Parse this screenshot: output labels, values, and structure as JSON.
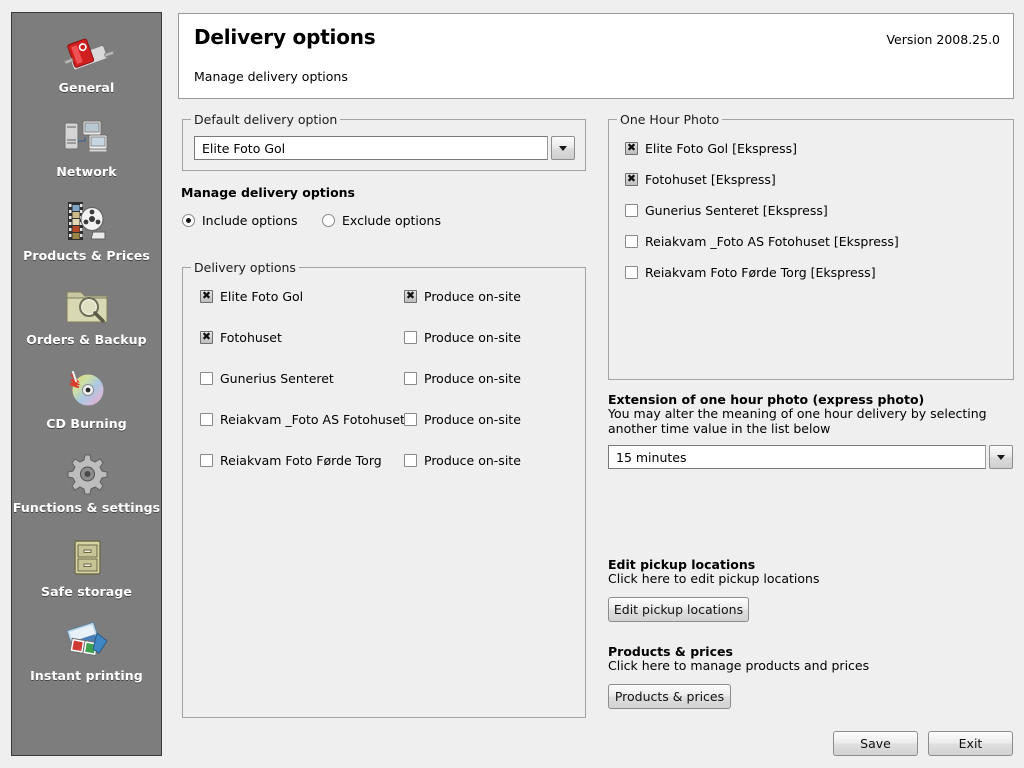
{
  "sidebar": {
    "items": [
      {
        "label": "General",
        "icon": "red-switch-icon"
      },
      {
        "label": "Network",
        "icon": "network-computers-icon"
      },
      {
        "label": "Products & Prices",
        "icon": "film-reel-icon"
      },
      {
        "label": "Orders & Backup",
        "icon": "folder-search-icon"
      },
      {
        "label": "CD Burning",
        "icon": "cd-disc-icon"
      },
      {
        "label": "Functions & settings",
        "icon": "gear-icon"
      },
      {
        "label": "Safe storage",
        "icon": "file-cabinet-icon"
      },
      {
        "label": "Instant printing",
        "icon": "photo-prints-icon"
      }
    ]
  },
  "header": {
    "title": "Delivery options",
    "subtitle": "Manage delivery options",
    "version": "Version 2008.25.0"
  },
  "default_delivery": {
    "group_title": "Default delivery option",
    "selected": "Elite Foto Gol"
  },
  "manage": {
    "heading": "Manage delivery options",
    "include_label": "Include options",
    "exclude_label": "Exclude options",
    "include_checked": true,
    "exclude_checked": false
  },
  "delivery_options": {
    "group_title": "Delivery options",
    "onsite_label": "Produce on-site",
    "rows": [
      {
        "label": "Elite Foto Gol",
        "checked": true,
        "onsite": true
      },
      {
        "label": "Fotohuset",
        "checked": true,
        "onsite": false
      },
      {
        "label": "Gunerius Senteret",
        "checked": false,
        "onsite": false
      },
      {
        "label": "Reiakvam _Foto AS Fotohuset",
        "checked": false,
        "onsite": false
      },
      {
        "label": "Reiakvam Foto Førde Torg",
        "checked": false,
        "onsite": false
      }
    ]
  },
  "one_hour_photo": {
    "group_title": "One Hour Photo",
    "rows": [
      {
        "label": "Elite Foto Gol [Ekspress]",
        "checked": true
      },
      {
        "label": "Fotohuset [Ekspress]",
        "checked": true
      },
      {
        "label": "Gunerius Senteret [Ekspress]",
        "checked": false
      },
      {
        "label": "Reiakvam _Foto AS Fotohuset [Ekspress]",
        "checked": false
      },
      {
        "label": "Reiakvam Foto Førde Torg [Ekspress]",
        "checked": false
      }
    ]
  },
  "extension": {
    "heading": "Extension of one hour photo (express photo)",
    "description_line1": "You may alter the meaning of one hour delivery by selecting",
    "description_line2": "another time value in the list below",
    "selected": "15 minutes"
  },
  "pickup": {
    "heading": "Edit pickup locations",
    "description": "Click here to edit pickup locations",
    "button_label": "Edit pickup locations"
  },
  "products": {
    "heading": "Products & prices",
    "description": "Click here to manage products and prices",
    "button_label": "Products & prices"
  },
  "footer": {
    "save_label": "Save",
    "exit_label": "Exit"
  },
  "colors": {
    "sidebar_bg": "#7d7d7d",
    "page_bg": "#efefef",
    "card_bg": "#ffffff",
    "group_border": "#a3a3a3"
  }
}
